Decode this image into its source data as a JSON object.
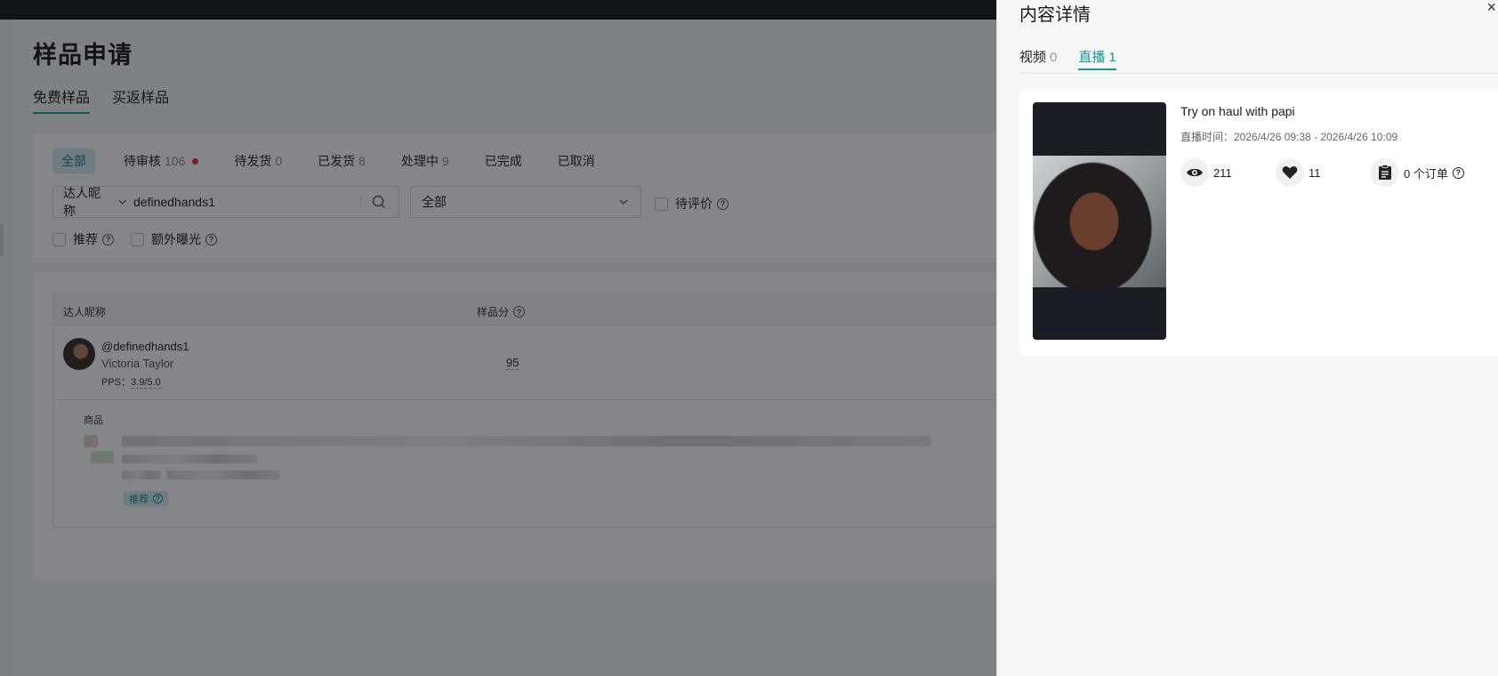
{
  "page": {
    "title": "样品申请",
    "tabs": [
      "免费样品",
      "买返样品"
    ],
    "status_filters": [
      {
        "label": "全部",
        "count": ""
      },
      {
        "label": "待审核",
        "count": "106"
      },
      {
        "label": "待发货",
        "count": "0"
      },
      {
        "label": "已发货",
        "count": "8"
      },
      {
        "label": "处理中",
        "count": "9"
      },
      {
        "label": "已完成",
        "count": ""
      },
      {
        "label": "已取消",
        "count": ""
      }
    ],
    "search": {
      "field_label": "达人昵称",
      "value": "definedhands1"
    },
    "dropdown_value": "全部",
    "check_pending_review": "待评价",
    "check_recommend": "推荐",
    "check_extra_exposure": "额外曝光"
  },
  "table": {
    "col_creator": "达人昵称",
    "col_sample_score": "样品分",
    "row": {
      "handle": "@definedhands1",
      "name": "Victoria Taylor",
      "pps_label": "PPS：",
      "pps_value": "3.9/5.0",
      "score": "95",
      "product_label": "商品",
      "tag": "推荐"
    }
  },
  "drawer": {
    "title": "内容详情",
    "close": "×",
    "tabs": [
      {
        "label": "视频",
        "count": "0"
      },
      {
        "label": "直播",
        "count": "1"
      }
    ],
    "live": {
      "title": "Try on haul with papi",
      "time": "直播时间：2026/4/26 09:38 - 2026/4/26 10:09",
      "views": "211",
      "likes": "11",
      "orders": "0 个订单"
    }
  },
  "colors": {
    "accent": "#15999c",
    "badge_dot": "#e0303a"
  }
}
